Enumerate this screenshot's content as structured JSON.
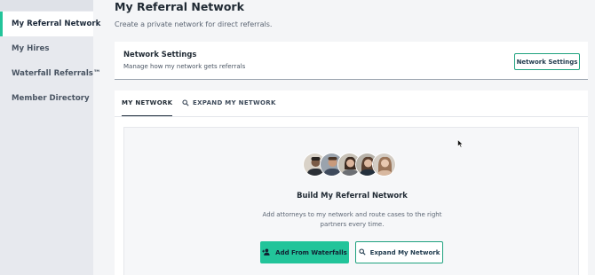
{
  "sidebar": {
    "items": [
      {
        "label": "My Referral Network",
        "active": true
      },
      {
        "label": "My Hires",
        "active": false
      },
      {
        "label": "Waterfall Referrals™",
        "active": false
      },
      {
        "label": "Member Directory",
        "active": false
      }
    ]
  },
  "header": {
    "title": "My Referral Network",
    "subtitle": "Create a private network for direct referrals."
  },
  "settings": {
    "title": "Network Settings",
    "description": "Manage how my network gets referrals",
    "button_label": "Network Settings"
  },
  "tabs": [
    {
      "label": "MY NETWORK",
      "active": true,
      "icon": null
    },
    {
      "label": "EXPAND MY NETWORK",
      "active": false,
      "icon": "search-icon"
    }
  ],
  "empty_state": {
    "title": "Build My Referral Network",
    "description": "Add attorneys to my network and route cases to the right partners every time.",
    "add_button_label": "Add From Waterfalls",
    "expand_button_label": "Expand My Network"
  },
  "colors": {
    "accent": "#22c49a",
    "accent_border": "#1fa27f",
    "sidebar_bg": "#e7e9ee",
    "page_bg": "#f4f5f7"
  }
}
